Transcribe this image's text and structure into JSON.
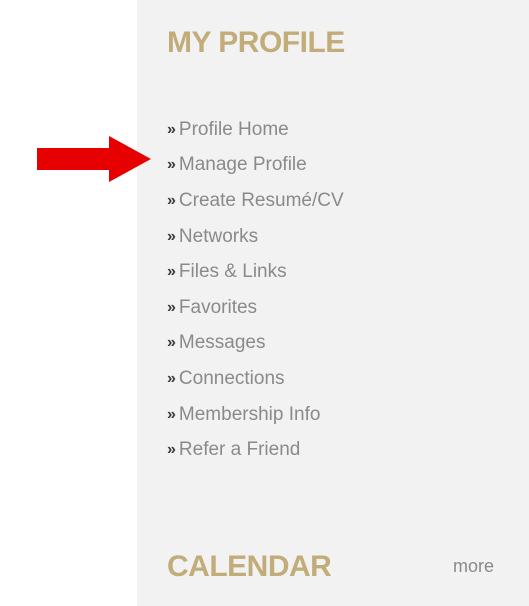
{
  "profile": {
    "heading": "MY PROFILE",
    "bullet": "»",
    "items": [
      {
        "label": "Profile Home"
      },
      {
        "label": "Manage Profile"
      },
      {
        "label": "Create Resumé/CV"
      },
      {
        "label": "Networks"
      },
      {
        "label": "Files & Links"
      },
      {
        "label": "Favorites"
      },
      {
        "label": "Messages"
      },
      {
        "label": "Connections"
      },
      {
        "label": "Membership Info"
      },
      {
        "label": "Refer a Friend"
      }
    ]
  },
  "calendar": {
    "heading": "CALENDAR",
    "more_label": "more"
  },
  "annotation": {
    "arrow_color": "#e60000",
    "points_to": "Manage Profile"
  },
  "colors": {
    "heading": "#c2ad7a",
    "link": "#8a8a8a",
    "bullet": "#3a3a3a",
    "panel_bg": "#f2f2f2"
  }
}
